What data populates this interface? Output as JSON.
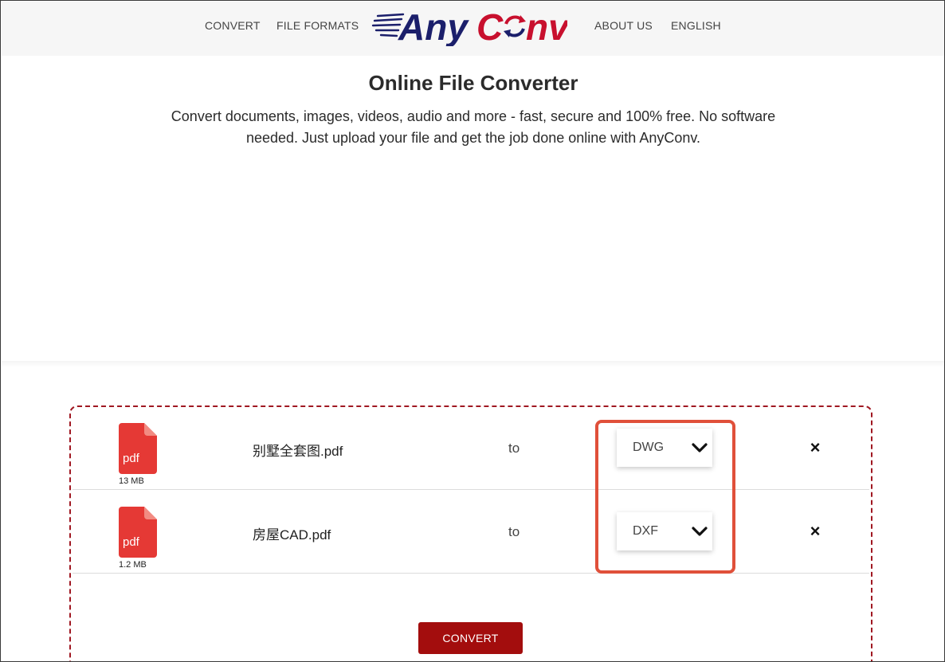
{
  "nav": {
    "convert": "CONVERT",
    "file_formats": "FILE FORMATS",
    "about_us": "ABOUT US",
    "language": "ENGLISH"
  },
  "logo": {
    "text_any": "Any",
    "text_c": "C",
    "text_nv": "nv",
    "colors": {
      "navy": "#1b1f6b",
      "red": "#c8102e"
    }
  },
  "hero": {
    "title": "Online File Converter",
    "description": "Convert documents, images, videos, audio and more - fast, secure and 100% free. No software needed. Just upload your file and get the job done online with AnyConv."
  },
  "files": [
    {
      "icon_label": "pdf",
      "size": "13 MB",
      "name": "别墅全套图.pdf",
      "to": "to",
      "format": "DWG",
      "remove": "×"
    },
    {
      "icon_label": "pdf",
      "size": "1.2 MB",
      "name": "房屋CAD.pdf",
      "to": "to",
      "format": "DXF",
      "remove": "×"
    }
  ],
  "convert_button": "CONVERT",
  "colors": {
    "accent": "#a30d0d",
    "dashed_border": "#a01822",
    "highlight": "#e0503a",
    "pdf_icon": "#e53935"
  }
}
